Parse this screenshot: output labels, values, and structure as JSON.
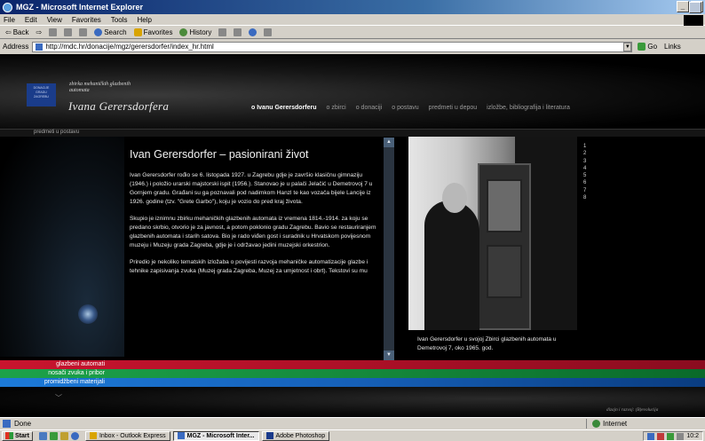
{
  "window": {
    "title": "MGZ - Microsoft Internet Explorer"
  },
  "menu": [
    "File",
    "Edit",
    "View",
    "Favorites",
    "Tools",
    "Help"
  ],
  "toolbar": {
    "back": "Back",
    "search": "Search",
    "favorites": "Favorites",
    "history": "History"
  },
  "address": {
    "label": "Address",
    "url": "http://mdc.hr/donacije/mgz/gerersdorfer/index_hr.html",
    "go": "Go",
    "links": "Links"
  },
  "site": {
    "brand_sub": "zbirka mehaničkih glazbenih automata",
    "brand_name": "Ivana Gerersdorfera",
    "brand_box": "DONACIJE GRADU ZAGREBU",
    "nav": [
      "o Ivanu Gerersdorferu",
      "o zbirci",
      "o donaciji",
      "o postavu",
      "predmeti u depou",
      "izložbe, bibliografija i literatura"
    ],
    "subnav": "predmeti u postavu",
    "article_title": "Ivan Gerersdorfer – pasionirani život",
    "paragraphs": [
      "Ivan Gerersdorfer rođio se 6. listopada 1927. u Zagrebu gdje je završio klasičnu gimnaziju (1946.) i položio urarski majstorski ispit (1956.). Stanovao je u palači Jelačić u Demetrovoj 7 u Gornjem gradu. Građani su ga poznavali pod nadimkom Hanzl te kao vozača bijele Lancije iz 1926. godine (tzv. \"Grete Garbo\"), koju je vozio do pred kraj života.",
      "Skupio je iznimnu zbirku mehaničkih glazbenih automata iz vremena 1814.-1914. za koju se predano skrbio, otvorio je za javnost, a potom poklonio gradu Zagrebu. Bavio se restauriranjem glazbenih automata i starih satova. Bio je rado viđen gost i suradnik u Hrvatskom povijesnom muzeju i Muzeju grada Zagreba, gdje je i održavao jedini muzejski orkestrion.",
      "Priredio je nekoliko tematskih izložaba o povijesti razvoja mehaničke automatizacije glazbe i tehnike zapisivanja zvuka (Muzej grada Zagreba, Muzej za umjetnost i obrt). Tekstovi su mu"
    ],
    "photo_caption": "Ivan Gerersdorfer u svojoj Zbirci glazbenih automata u Demetrovoj 7, oko 1965. god.",
    "photo_numbers": [
      "1",
      "2",
      "3",
      "4",
      "5",
      "6",
      "7",
      "8"
    ],
    "categories": [
      "glazbeni automati",
      "nosači zvuka i pribor",
      "promidžbeni materijali"
    ],
    "credit": "dizajn i razvoj: (B)evolucija"
  },
  "status": {
    "text": "Done",
    "zone": "Internet"
  },
  "taskbar": {
    "start": "Start",
    "tasks": [
      "Inbox - Outlook Express",
      "MGZ - Microsoft Inter...",
      "Adobe Photoshop"
    ],
    "clock": "10:2"
  },
  "colors": {
    "red_bar": "#c8142e",
    "green_bar": "#1ca24a",
    "blue_bar": "#1c7ad8",
    "titlebar": "#0a246a"
  }
}
